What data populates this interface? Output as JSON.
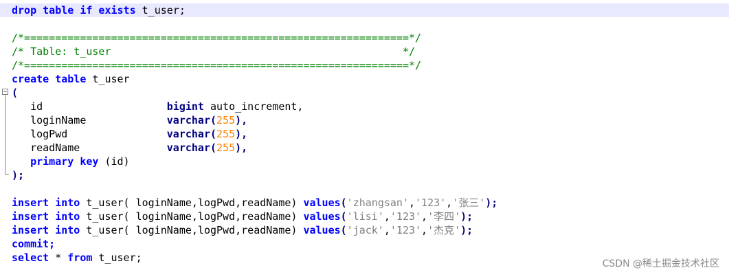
{
  "editor": {
    "lines": [
      [
        {
          "t": "drop table if exists ",
          "c": "kw"
        },
        {
          "t": "t_user;",
          "c": "plain"
        }
      ],
      [],
      [
        {
          "t": "/*==============================================================*/",
          "c": "cm"
        }
      ],
      [
        {
          "t": "/* Table: t_user                                               */",
          "c": "cm"
        }
      ],
      [
        {
          "t": "/*==============================================================*/",
          "c": "cm"
        }
      ],
      [
        {
          "t": "create table ",
          "c": "kw"
        },
        {
          "t": "t_user",
          "c": "plain"
        }
      ],
      [
        {
          "t": "(",
          "c": "op"
        }
      ],
      [
        {
          "t": "   id                    ",
          "c": "plain"
        },
        {
          "t": "bigint ",
          "c": "kw2"
        },
        {
          "t": "auto_increment,",
          "c": "plain"
        }
      ],
      [
        {
          "t": "   loginName             ",
          "c": "plain"
        },
        {
          "t": "varchar",
          "c": "kw2"
        },
        {
          "t": "(",
          "c": "op"
        },
        {
          "t": "255",
          "c": "num"
        },
        {
          "t": "),",
          "c": "op"
        }
      ],
      [
        {
          "t": "   logPwd                ",
          "c": "plain"
        },
        {
          "t": "varchar",
          "c": "kw2"
        },
        {
          "t": "(",
          "c": "op"
        },
        {
          "t": "255",
          "c": "num"
        },
        {
          "t": "),",
          "c": "op"
        }
      ],
      [
        {
          "t": "   readName              ",
          "c": "plain"
        },
        {
          "t": "varchar",
          "c": "kw2"
        },
        {
          "t": "(",
          "c": "op"
        },
        {
          "t": "255",
          "c": "num"
        },
        {
          "t": "),",
          "c": "op"
        }
      ],
      [
        {
          "t": "   primary key ",
          "c": "kw"
        },
        {
          "t": "(id)",
          "c": "plain"
        }
      ],
      [
        {
          "t": ");",
          "c": "op"
        }
      ],
      [],
      [
        {
          "t": "insert into ",
          "c": "kw"
        },
        {
          "t": "t_user( loginName,logPwd,readName) ",
          "c": "plain"
        },
        {
          "t": "values",
          "c": "kw"
        },
        {
          "t": "(",
          "c": "op"
        },
        {
          "t": "'zhangsan'",
          "c": "str"
        },
        {
          "t": ",",
          "c": "plain"
        },
        {
          "t": "'123'",
          "c": "str"
        },
        {
          "t": ",",
          "c": "plain"
        },
        {
          "t": "'张三'",
          "c": "str"
        },
        {
          "t": ");",
          "c": "op"
        }
      ],
      [
        {
          "t": "insert into ",
          "c": "kw"
        },
        {
          "t": "t_user( loginName,logPwd,readName) ",
          "c": "plain"
        },
        {
          "t": "values",
          "c": "kw"
        },
        {
          "t": "(",
          "c": "op"
        },
        {
          "t": "'lisi'",
          "c": "str"
        },
        {
          "t": ",",
          "c": "plain"
        },
        {
          "t": "'123'",
          "c": "str"
        },
        {
          "t": ",",
          "c": "plain"
        },
        {
          "t": "'李四'",
          "c": "str"
        },
        {
          "t": ");",
          "c": "op"
        }
      ],
      [
        {
          "t": "insert into ",
          "c": "kw"
        },
        {
          "t": "t_user( loginName,logPwd,readName) ",
          "c": "plain"
        },
        {
          "t": "values",
          "c": "kw"
        },
        {
          "t": "(",
          "c": "op"
        },
        {
          "t": "'jack'",
          "c": "str"
        },
        {
          "t": ",",
          "c": "plain"
        },
        {
          "t": "'123'",
          "c": "str"
        },
        {
          "t": ",",
          "c": "plain"
        },
        {
          "t": "'杰克'",
          "c": "str"
        },
        {
          "t": ");",
          "c": "op"
        }
      ],
      [
        {
          "t": "commit;",
          "c": "kw"
        }
      ],
      [
        {
          "t": "select ",
          "c": "kw"
        },
        {
          "t": "* ",
          "c": "plain"
        },
        {
          "t": "from ",
          "c": "kw"
        },
        {
          "t": "t_user;",
          "c": "plain"
        }
      ]
    ]
  },
  "watermark": "CSDN @稀土掘金技术社区"
}
